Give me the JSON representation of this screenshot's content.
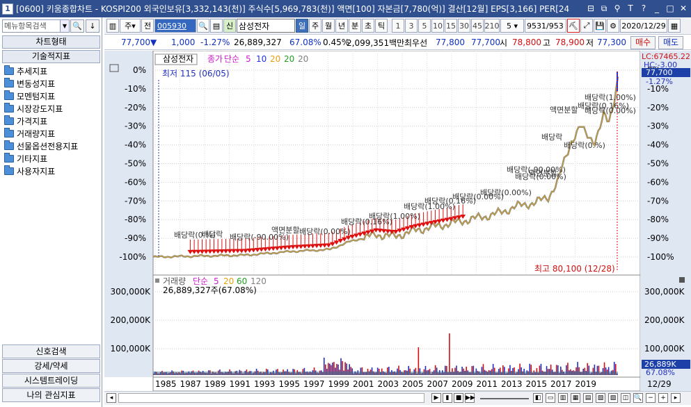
{
  "window": {
    "number": "1",
    "title": "[0600] 키움종합차트 - KOSPI200 외국인보유[3,332,143(천)] 주식수[5,969,783(천)] 액면[100] 자본금[7,780(억)] 결산[12월] EPS[3,166] PER[24"
  },
  "left_panel": {
    "search_placeholder": "메뉴항목검색",
    "chart_type_header": "차트형태",
    "tech_header": "기술적지표",
    "indicators": [
      "추세지표",
      "변동성지표",
      "모멘텀지표",
      "시장강도지표",
      "가격지표",
      "거래량지표",
      "선물옵션전용지표",
      "기타지표",
      "사용자지표"
    ],
    "bottom_buttons": [
      "신호검색",
      "강세/약세",
      "시스템트레이딩",
      "나의 관심지표"
    ]
  },
  "toolbar": {
    "jong": "주",
    "jeon": "전",
    "code": "005930",
    "sin": "신",
    "stock_name": "삼성전자",
    "periods": [
      "일",
      "주",
      "월",
      "년",
      "분",
      "초",
      "틱"
    ],
    "active_period": "일",
    "intervals": [
      "1",
      "3",
      "5",
      "10",
      "15",
      "30",
      "45",
      "210"
    ],
    "count": "5",
    "range": "9531",
    "range_total": "/953",
    "date": "2020/12/29"
  },
  "info": {
    "price": "77,700",
    "arrow": "▼",
    "change": "1,000",
    "rate": "-1.27%",
    "volume": "26,889,327",
    "vol_ratio": "67.08%",
    "r2": "0.45%",
    "amount": "2,099,351백만",
    "pref_label": "최우선",
    "bid1": "77,800",
    "ask1": "77,700",
    "open_label": "시",
    "open": "78,800",
    "high_label": "고",
    "high": "78,900",
    "low_label": "저",
    "low": "77,300",
    "buy": "매수",
    "sell": "매도"
  },
  "price_pane": {
    "legend_name": "삼성전자",
    "legend_close": "종가",
    "legend_type": "단순",
    "ma": [
      "5",
      "10",
      "20",
      "20",
      "20"
    ],
    "ma_colors": [
      "#d01cd0",
      "#2030e0",
      "#e8a010",
      "#20a020",
      "#808080"
    ],
    "min_note": "최저 115 (06/05)",
    "max_note": "최고 80,100 (12/28)",
    "right_lc": "LC:67465.22",
    "right_hc": "HC:-3.00",
    "right_price": "77,700",
    "right_rate": "-1.27%",
    "yticks": [
      "0%",
      "-10%",
      "-20%",
      "-30%",
      "-40%",
      "-50%",
      "-60%",
      "-70%",
      "-80%",
      "-90%",
      "-100%"
    ],
    "annotation_texts": [
      "배당락(1.00%)",
      "배당락(0.16%)",
      "배당락(0.00%)",
      "액면분할",
      "배당락",
      "배당락(0.%)",
      "배당락(-90.00%)",
      "배당락(0.00%)"
    ]
  },
  "volume_pane": {
    "legend_name": "거래량",
    "legend_type": "단순",
    "ma": [
      "5",
      "20",
      "60",
      "120"
    ],
    "ma_colors": [
      "#d01cd0",
      "#e8a010",
      "#20a020",
      "#808080"
    ],
    "value": "26,889,327주(67.08%)",
    "yticks": [
      "300,000K",
      "200,000K",
      "100,000K"
    ],
    "right_value": "26,889K",
    "right_rate": "67.08%"
  },
  "xaxis": {
    "years": [
      "1985",
      "1987",
      "1989",
      "1991",
      "1993",
      "1995",
      "1997",
      "1999",
      "2001",
      "2003",
      "2005",
      "2007",
      "2009",
      "2011",
      "2013",
      "2015",
      "2017",
      "2019"
    ],
    "right_label": "12/29"
  },
  "colors": {
    "title_bg": "#2f4f8f",
    "up": "#d01010",
    "down": "#1030c0",
    "price_line": "#c8a040"
  }
}
